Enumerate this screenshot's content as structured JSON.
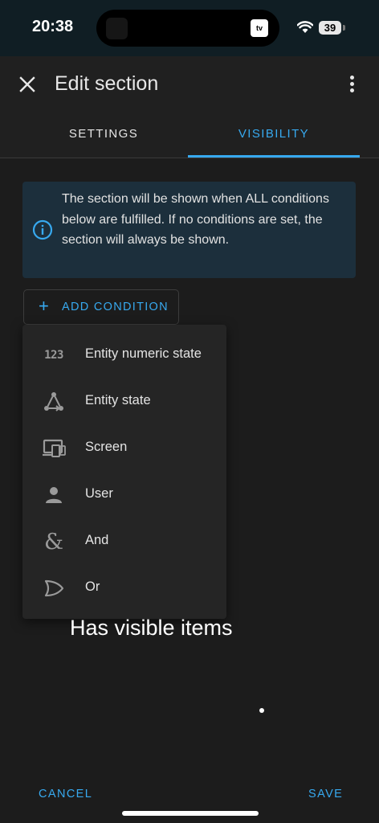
{
  "status_bar": {
    "time": "20:38",
    "tv_badge": "tv",
    "battery": "39"
  },
  "header": {
    "title": "Edit section",
    "close_icon": "close-icon",
    "menu_icon": "more-vertical-icon"
  },
  "tabs": [
    {
      "label": "SETTINGS",
      "active": false
    },
    {
      "label": "VISIBILITY",
      "active": true
    }
  ],
  "info": {
    "icon": "info-circle-icon",
    "text": "The section will be shown when ALL conditions below are fulfilled. If no conditions are set, the section will always be shown."
  },
  "add_condition": {
    "label": "ADD CONDITION",
    "icon": "plus-icon"
  },
  "menu": {
    "items": [
      {
        "label": "Entity numeric state",
        "icon": "numeric-icon",
        "glyph": "123"
      },
      {
        "label": "Entity state",
        "icon": "state-machine-icon"
      },
      {
        "label": "Screen",
        "icon": "responsive-screen-icon"
      },
      {
        "label": "User",
        "icon": "account-icon"
      },
      {
        "label": "And",
        "icon": "ampersand-icon",
        "glyph": "&"
      },
      {
        "label": "Or",
        "icon": "gate-or-icon"
      }
    ]
  },
  "placeholder": {
    "text": "Has visible items"
  },
  "footer": {
    "cancel": "CANCEL",
    "save": "SAVE"
  },
  "colors": {
    "accent": "#37a9ef",
    "background": "#1c1c1c",
    "info_background": "#1c2f3c"
  }
}
